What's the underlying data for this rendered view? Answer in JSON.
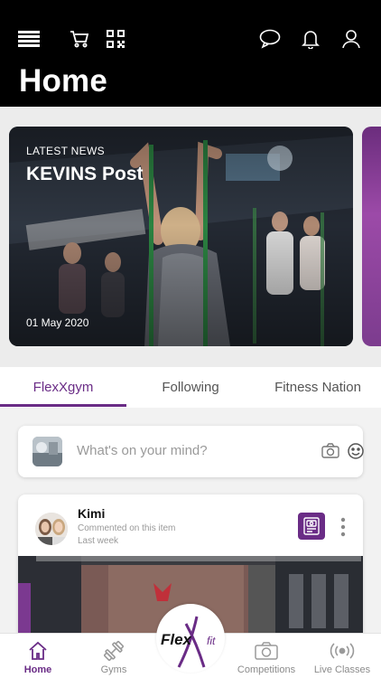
{
  "header": {
    "title": "Home",
    "icons": [
      "menu-icon",
      "cart-icon",
      "qr-code-icon",
      "chat-icon",
      "bell-icon",
      "user-icon"
    ]
  },
  "news": {
    "kicker": "LATEST NEWS",
    "title": "KEVINS Post",
    "date": "01 May 2020"
  },
  "tabs": [
    {
      "label": "FlexXgym",
      "active": true
    },
    {
      "label": "Following",
      "active": false
    },
    {
      "label": "Fitness Nation",
      "active": false
    }
  ],
  "composer": {
    "placeholder": "What's on your mind?"
  },
  "post": {
    "author": "Kimi",
    "activity": "Commented on this item",
    "time": "Last week"
  },
  "bottom_nav": [
    {
      "label": "Home",
      "icon": "home-icon",
      "active": true
    },
    {
      "label": "Gyms",
      "icon": "dumbbell-icon",
      "active": false
    },
    {
      "label": "Competitions",
      "icon": "camera-icon",
      "active": false
    },
    {
      "label": "Live Classes",
      "icon": "broadcast-icon",
      "active": false
    }
  ],
  "logo": {
    "brand": "Flex",
    "suffix": "fit"
  },
  "colors": {
    "accent": "#6a2c86",
    "header_bg": "#000000"
  }
}
